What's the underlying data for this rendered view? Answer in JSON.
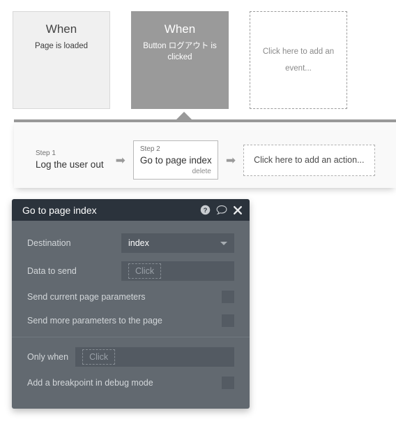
{
  "workflow": {
    "events": [
      {
        "title": "When",
        "subtitle": "Page is loaded",
        "state": "normal"
      },
      {
        "title": "When",
        "subtitle": "Button ログアウト is clicked",
        "state": "selected"
      },
      {
        "placeholder": "Click here to add an event...",
        "state": "empty"
      }
    ],
    "steps": [
      {
        "number": "Step 1",
        "label": "Log the user out"
      },
      {
        "number": "Step 2",
        "label": "Go to page index",
        "delete_label": "delete"
      }
    ],
    "arrow_glyph": "➡",
    "add_action_placeholder": "Click here to add an action..."
  },
  "panel": {
    "title": "Go to page index",
    "icons": {
      "help": "help-circle-icon",
      "comment": "speech-bubble-icon",
      "close": "close-icon"
    },
    "fields": [
      {
        "label": "Destination",
        "type": "select",
        "value": "index"
      },
      {
        "label": "Data to send",
        "type": "expression",
        "placeholder": "Click"
      }
    ],
    "checkboxes": [
      {
        "label": "Send current page parameters",
        "checked": false
      },
      {
        "label": "Send more parameters to the page",
        "checked": false
      }
    ],
    "only_when": {
      "label": "Only when",
      "placeholder": "Click"
    },
    "breakpoint": {
      "label": "Add a breakpoint in debug mode",
      "checked": false
    }
  },
  "colors": {
    "panel_header_bg": "#2b333c",
    "panel_body_bg": "#626970",
    "field_bg": "#535a62",
    "selected_card_bg": "#9a9a9a",
    "light_card_bg": "#f0f0f0"
  }
}
